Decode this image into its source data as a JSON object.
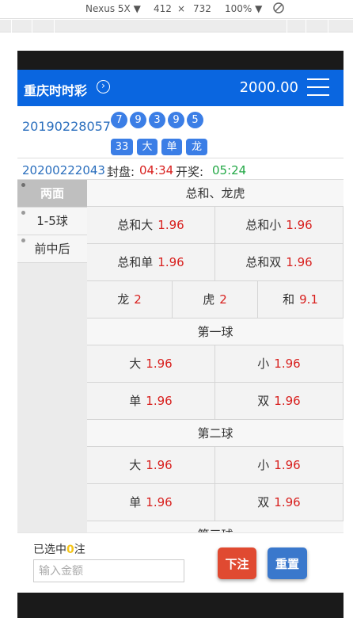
{
  "devtools": {
    "device": "Nexus 5X ▼",
    "width": "412",
    "times": "×",
    "height": "732",
    "zoom": "100% ▼"
  },
  "header": {
    "title": "重庆时时彩",
    "chevron": "›",
    "balance": "2000.00"
  },
  "result": {
    "issue": "20190228057",
    "balls": [
      "7",
      "9",
      "3",
      "9",
      "5"
    ],
    "tags": [
      "33",
      "大",
      "单",
      "龙"
    ]
  },
  "countdown": {
    "issue": "20200222043",
    "close_label": "封盘:",
    "close_time": "04:34",
    "open_label": "开奖:",
    "open_time": "05:24"
  },
  "nav": {
    "items": [
      {
        "label": "两面"
      },
      {
        "label": "1-5球"
      },
      {
        "label": "前中后"
      }
    ]
  },
  "sections": {
    "sum": {
      "title": "总和、龙虎",
      "big": {
        "name": "总和大",
        "odds": "1.96"
      },
      "small": {
        "name": "总和小",
        "odds": "1.96"
      },
      "odd": {
        "name": "总和单",
        "odds": "1.96"
      },
      "even": {
        "name": "总和双",
        "odds": "1.96"
      },
      "dragon": {
        "name": "龙",
        "odds": "2"
      },
      "tiger": {
        "name": "虎",
        "odds": "2"
      },
      "tie": {
        "name": "和",
        "odds": "9.1"
      }
    },
    "ball1": {
      "title": "第一球",
      "big": {
        "name": "大",
        "odds": "1.96"
      },
      "small": {
        "name": "小",
        "odds": "1.96"
      },
      "odd": {
        "name": "单",
        "odds": "1.96"
      },
      "even": {
        "name": "双",
        "odds": "1.96"
      }
    },
    "ball2": {
      "title": "第二球",
      "big": {
        "name": "大",
        "odds": "1.96"
      },
      "small": {
        "name": "小",
        "odds": "1.96"
      },
      "odd": {
        "name": "单",
        "odds": "1.96"
      },
      "even": {
        "name": "双",
        "odds": "1.96"
      }
    },
    "ball3": {
      "title": "第三球"
    }
  },
  "footer": {
    "selected_prefix": "已选中",
    "selected_count": "0",
    "selected_suffix": "注",
    "amount_placeholder": "输入金额",
    "bet_label": "下注",
    "reset_label": "重置"
  }
}
